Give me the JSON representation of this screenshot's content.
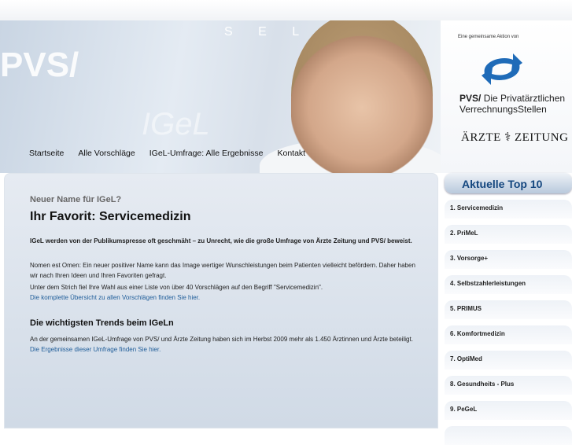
{
  "banner": {
    "brand": "PVS/",
    "sel": "S E L",
    "igel": "IGeL"
  },
  "nav": [
    "Startseite",
    "Alle Vorschläge",
    "IGeL-Umfrage: Alle Ergebnisse",
    "Kontakt"
  ],
  "logos": {
    "intro": "Eine gemeinsame Aktion von",
    "pvs_bold": "PVS/",
    "pvs_line1": " Die Privatärztlichen",
    "pvs_line2": "VerrechnungsStellen",
    "aerzte": "ÄRZTE ⚕ ZEITUNG"
  },
  "main": {
    "kicker": "Neuer Name für IGeL?",
    "title": "Ihr Favorit: Servicemedizin",
    "lead": "IGeL werden von der Publikumspresse oft geschmäht – zu Unrecht, wie die große Umfrage von Ärzte Zeitung und PVS/ beweist.",
    "p1": "Nomen est Omen: Ein neuer positiver Name kann das Image wertiger Wunschleistungen beim Patienten vielleicht befördern. Daher haben wir nach Ihren Ideen und Ihren Favoriten gefragt.",
    "p2": "Unter dem Strich fiel Ihre Wahl aus einer Liste von über 40 Vorschlägen auf den Begriff \"Servicemedizin\".",
    "link1": "Die komplette Übersicht zu allen Vorschlägen finden Sie hier.",
    "h2": "Die wichtigsten Trends beim IGeLn",
    "p3": "An der gemeinsamen IGeL-Umfrage von PVS/ und Ärzte Zeitung haben sich im Herbst 2009 mehr als 1.450 Ärztinnen und Ärzte beteiligt. ",
    "link2": "Die Ergebnisse dieser Umfrage finden Sie hier."
  },
  "side": {
    "title": "Aktuelle Top 10",
    "items": [
      "1. Servicemedizin",
      "2. PriMeL",
      "3. Vorsorge+",
      "4. Selbstzahlerleistungen",
      "5. PRIMUS",
      "6. Komfortmedizin",
      "7. OptiMed",
      "8. Gesundheits - Plus",
      "9. PeGeL"
    ]
  }
}
